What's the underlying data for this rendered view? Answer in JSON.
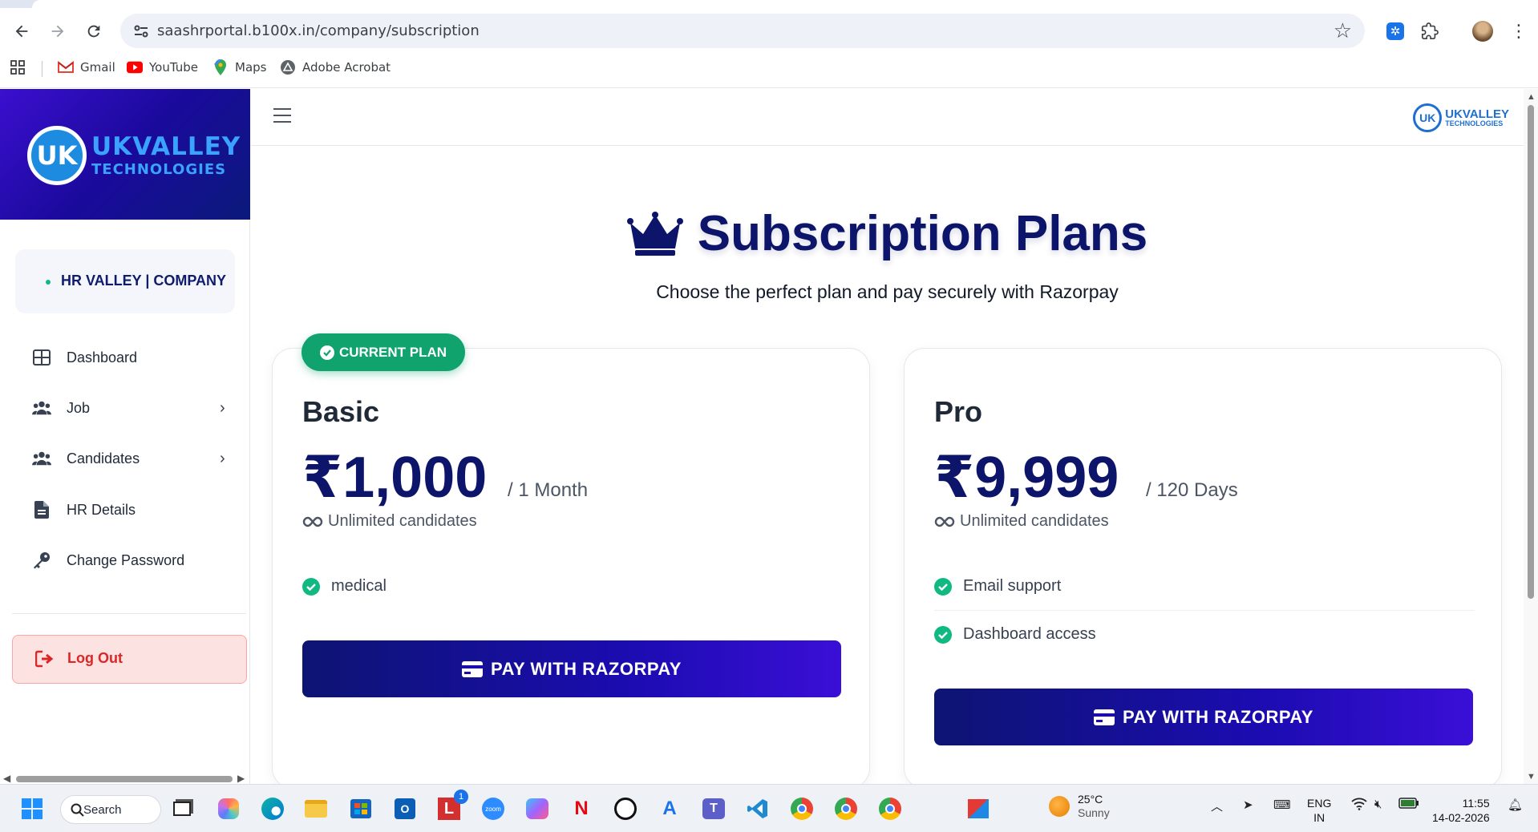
{
  "browser": {
    "url": "saashrportal.b100x.in/company/subscription",
    "bookmarks": [
      {
        "label": "Gmail",
        "icon": "gmail-icon"
      },
      {
        "label": "YouTube",
        "icon": "youtube-icon"
      },
      {
        "label": "Maps",
        "icon": "maps-icon"
      },
      {
        "label": "Adobe Acrobat",
        "icon": "acrobat-icon"
      }
    ]
  },
  "sidebar": {
    "brand_name": "UKVALLEY",
    "brand_sub": "TECHNOLOGIES",
    "brand_logo_letters": "UK",
    "company_name": "HR VALLEY | COMPANY",
    "menu": [
      {
        "label": "Dashboard",
        "icon": "dashboard-grid-icon",
        "has_submenu": false
      },
      {
        "label": "Job",
        "icon": "users-icon",
        "has_submenu": true
      },
      {
        "label": "Candidates",
        "icon": "users-icon",
        "has_submenu": true
      },
      {
        "label": "HR Details",
        "icon": "document-icon",
        "has_submenu": false
      },
      {
        "label": "Change Password",
        "icon": "key-icon",
        "has_submenu": false
      }
    ],
    "logout_label": "Log Out"
  },
  "header": {
    "logo_name": "UKVALLEY",
    "logo_sub": "TECHNOLOGIES",
    "logo_letters": "UK"
  },
  "page": {
    "title": "Subscription Plans",
    "subtitle": "Choose the perfect plan and pay securely with Razorpay",
    "current_badge": "CURRENT PLAN",
    "pay_label": "PAY WITH RAZORPAY",
    "plans": [
      {
        "name": "Basic",
        "price": "₹1,000",
        "period": "/ 1 Month",
        "limit": "Unlimited candidates",
        "current": true,
        "features": [
          "medical"
        ]
      },
      {
        "name": "Pro",
        "price": "₹9,999",
        "period": "/ 120 Days",
        "limit": "Unlimited candidates",
        "current": false,
        "features": [
          "Email support",
          "Dashboard access"
        ]
      }
    ]
  },
  "taskbar": {
    "search_label": "Search",
    "weather_temp": "25°C",
    "weather_cond": "Sunny",
    "lang_1": "ENG",
    "lang_2": "IN",
    "time": "11:55",
    "date": "14-02-2026",
    "badge_l_count": "1"
  },
  "colors": {
    "accent_navy": "#0c1569",
    "success_green": "#10a36e",
    "danger_red": "#dc2626"
  }
}
